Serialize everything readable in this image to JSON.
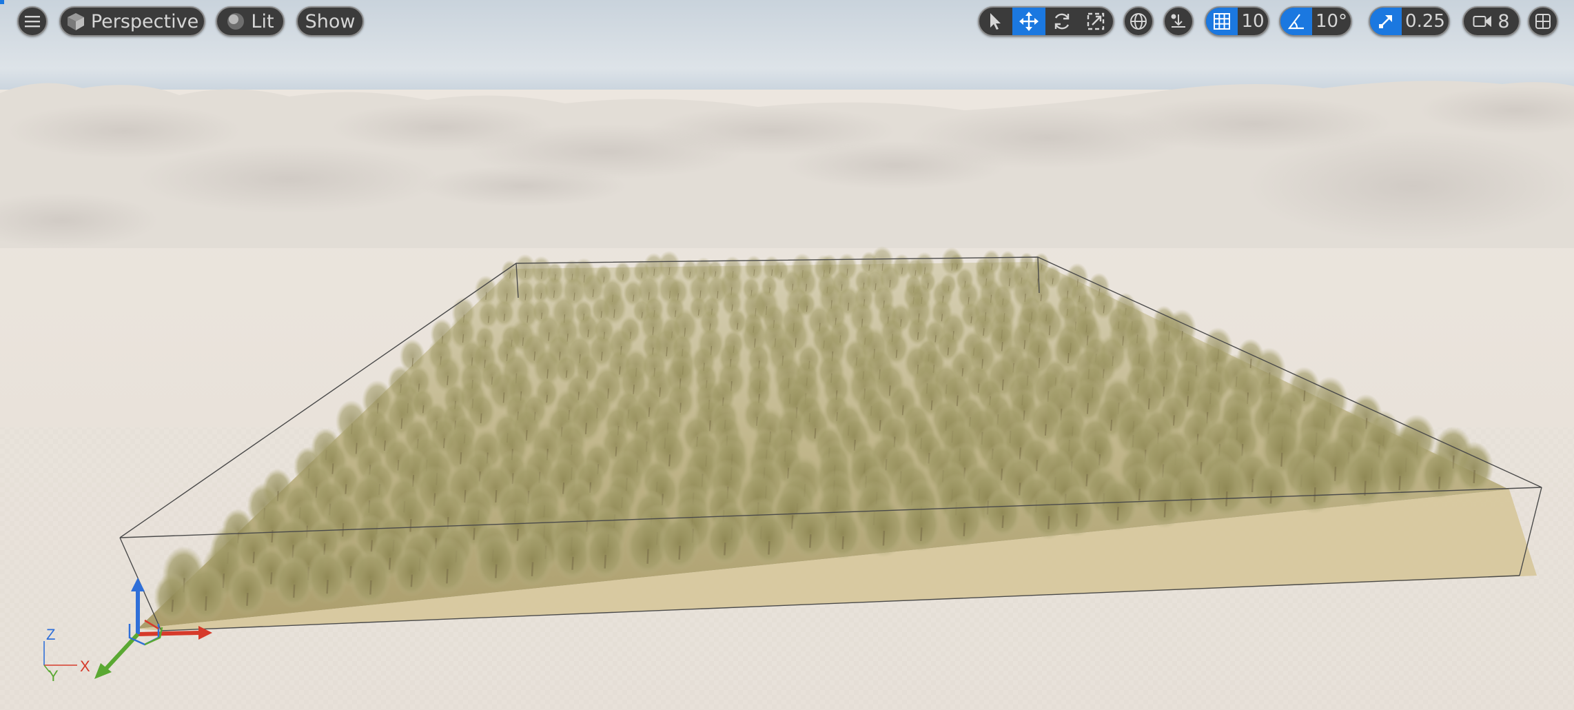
{
  "toolbar": {
    "menu_icon": "hamburger-icon",
    "view_mode": {
      "label": "Perspective",
      "icon": "cube-icon"
    },
    "lighting_mode": {
      "label": "Lit",
      "icon": "lit-sphere-icon"
    },
    "show_label": "Show",
    "transform_tools": [
      "select-arrow-icon",
      "translate-icon",
      "rotate-icon",
      "scale-icon"
    ],
    "active_tool": "translate-icon",
    "coordinate_space_icon": "globe-icon",
    "surface_snap_icon": "surface-snap-icon",
    "grid_snap": {
      "icon": "grid-icon",
      "value": "10",
      "enabled": true
    },
    "rotation_snap": {
      "icon": "angle-icon",
      "value": "10°",
      "enabled": true
    },
    "scale_snap": {
      "icon": "scale-arrow-icon",
      "value": "0.25",
      "enabled": true
    },
    "camera_speed": {
      "icon": "camera-icon",
      "value": "8"
    },
    "layout_icon": "viewport-layout-icon"
  },
  "axis_gizmo": {
    "z": "Z",
    "x": "X",
    "y": "Y"
  },
  "colors": {
    "accent": "#1b78e0",
    "toolbar_bg": "#3b3b3b",
    "toolbar_border": "#8c8c8c",
    "x_axis": "#d63a2a",
    "y_axis": "#5aa832",
    "z_axis": "#2f6fd8"
  }
}
